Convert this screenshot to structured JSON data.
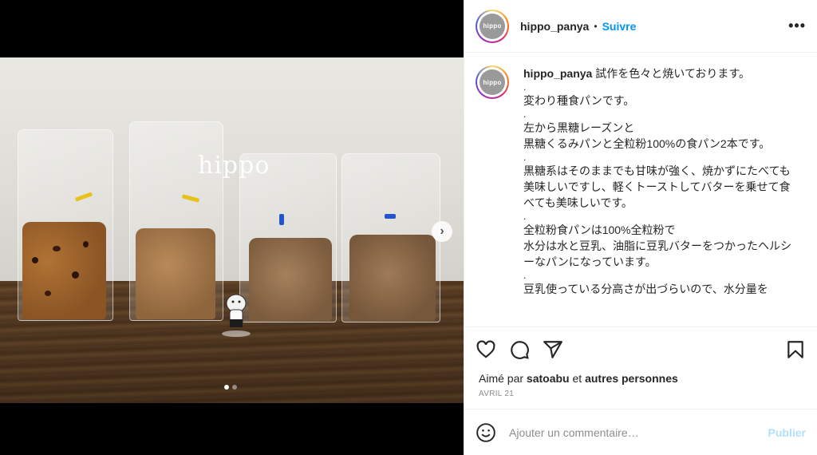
{
  "media": {
    "watermark": "hippo",
    "next_label": "›",
    "carousel_count": 2,
    "carousel_active": 1
  },
  "header": {
    "avatar_text": "hippo",
    "username": "hippo_panya",
    "separator": "•",
    "follow_label": "Suivre",
    "more_label": "•••"
  },
  "caption": {
    "username": "hippo_panya",
    "first_line": " 試作を色々と焼いております。",
    "lines": [
      {
        "text": ".",
        "dot": true
      },
      {
        "text": "変わり種食パンです。",
        "dot": false
      },
      {
        "text": ".",
        "dot": true
      },
      {
        "text": "左から黒糖レーズンと",
        "dot": false
      },
      {
        "text": "黒糖くるみパンと全粒粉100%の食パン2本です。",
        "dot": false
      },
      {
        "text": ".",
        "dot": true
      },
      {
        "text": "黒糖系はそのままでも甘味が強く、焼かずにたべても美味しいですし、軽くトーストしてバターを乗せて食べても美味しいです。",
        "dot": false
      },
      {
        "text": ".",
        "dot": true
      },
      {
        "text": "全粒粉食パンは100%全粒粉で",
        "dot": false
      },
      {
        "text": "水分は水と豆乳、油脂に豆乳バターをつかったヘルシーなパンになっています。",
        "dot": false
      },
      {
        "text": ".",
        "dot": true
      },
      {
        "text": "豆乳使っている分高さが出づらいので、水分量を",
        "dot": false
      }
    ]
  },
  "actions": {
    "like_icon": "heart-icon",
    "comment_icon": "comment-icon",
    "share_icon": "paper-plane-icon",
    "save_icon": "bookmark-icon"
  },
  "likes": {
    "prefix": "Aimé par ",
    "user": "satoabu",
    "middle": " et ",
    "others": "autres personnes"
  },
  "date": "AVRIL 21",
  "comment": {
    "placeholder": "Ajouter un commentaire…",
    "publish_label": "Publier",
    "emoji_icon": "smiley-icon"
  }
}
